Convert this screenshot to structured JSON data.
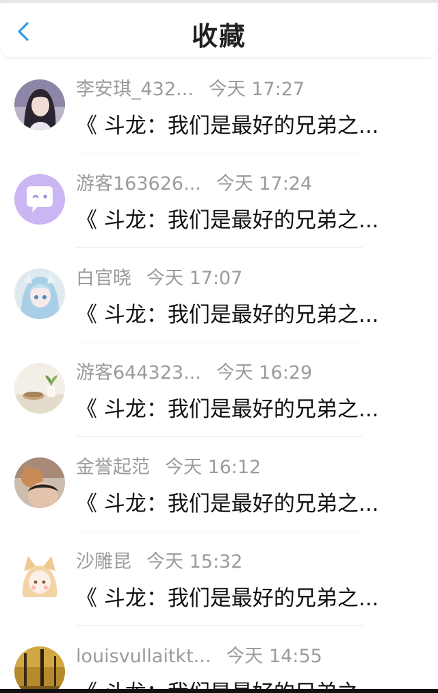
{
  "header": {
    "title": "收藏",
    "back_icon": "chevron-left-icon",
    "back_color": "#2a9af0"
  },
  "items": [
    {
      "name": "李安琪_432...",
      "time": "今天 17:27",
      "content": "《 斗龙：我们是最好的兄弟之...",
      "avatar": "avatar-girl-photo"
    },
    {
      "name": "游客163626...",
      "time": "今天 17:24",
      "content": "《 斗龙：我们是最好的兄弟之...",
      "avatar": "avatar-chat-bubble-purple"
    },
    {
      "name": "白官晓",
      "time": "今天 17:07",
      "content": "《 斗龙：我们是最好的兄弟之...",
      "avatar": "avatar-anime-blue-hair"
    },
    {
      "name": "游客644323...",
      "time": "今天 16:29",
      "content": "《 斗龙：我们是最好的兄弟之...",
      "avatar": "avatar-plant-bowls"
    },
    {
      "name": "金誉起范",
      "time": "今天 16:12",
      "content": "《 斗龙：我们是最好的兄弟之...",
      "avatar": "avatar-person-cat"
    },
    {
      "name": "沙雕昆",
      "time": "今天 15:32",
      "content": "《 斗龙：我们是最好的兄弟之...",
      "avatar": "avatar-anime-fox-ears"
    },
    {
      "name": "louisvullaitkt...",
      "time": "今天 14:55",
      "content": "《 斗龙：我们是最好的兄弟之...",
      "avatar": "avatar-autumn-trees"
    }
  ]
}
